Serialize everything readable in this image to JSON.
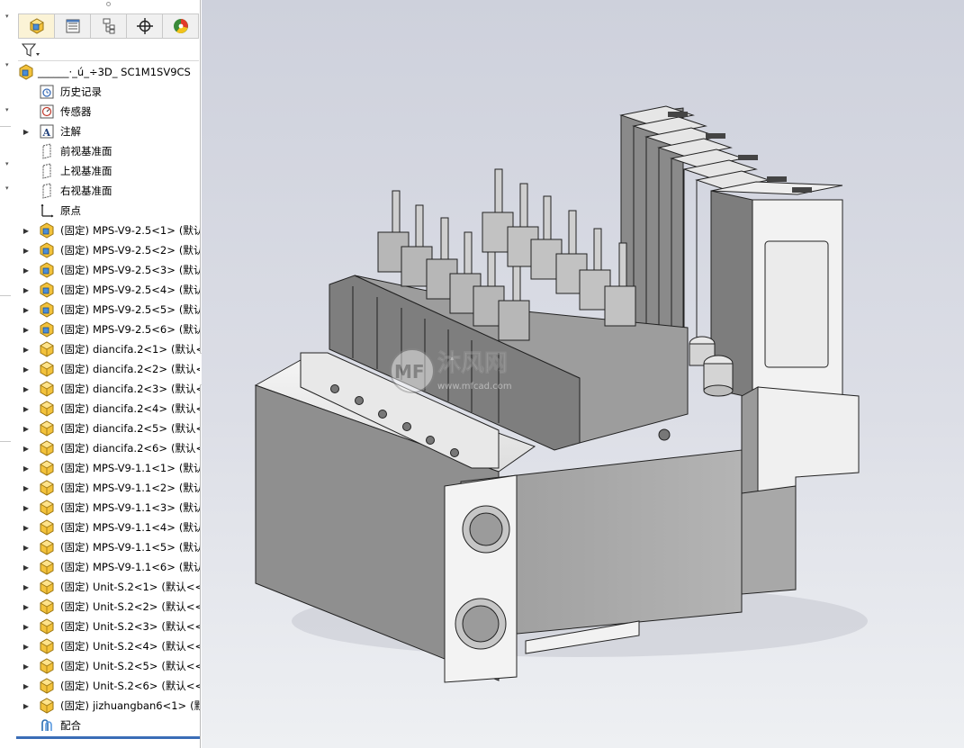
{
  "panel": {
    "tabs": [
      {
        "icon": "feature-manager-icon"
      },
      {
        "icon": "property-manager-icon"
      },
      {
        "icon": "configuration-manager-icon"
      },
      {
        "icon": "dimxpert-icon"
      },
      {
        "icon": "display-manager-icon"
      }
    ],
    "filter_icon": "filter-icon"
  },
  "tree": {
    "root": "______·_ú_÷3D_ SC1M1SV9CS",
    "history": "历史记录",
    "sensors": "传感器",
    "annotations": "注解",
    "front_plane": "前视基准面",
    "top_plane": "上视基准面",
    "right_plane": "右视基准面",
    "origin": "原点",
    "fixed_label": "(固定)",
    "components": [
      {
        "name": "MPS-V9-2.5<1>",
        "config": "(默认",
        "kind": "assembly"
      },
      {
        "name": "MPS-V9-2.5<2>",
        "config": "(默认",
        "kind": "assembly"
      },
      {
        "name": "MPS-V9-2.5<3>",
        "config": "(默认",
        "kind": "assembly"
      },
      {
        "name": "MPS-V9-2.5<4>",
        "config": "(默认",
        "kind": "assembly"
      },
      {
        "name": "MPS-V9-2.5<5>",
        "config": "(默认",
        "kind": "assembly"
      },
      {
        "name": "MPS-V9-2.5<6>",
        "config": "(默认",
        "kind": "assembly"
      },
      {
        "name": "diancifa.2<1>",
        "config": "(默认<",
        "kind": "part"
      },
      {
        "name": "diancifa.2<2>",
        "config": "(默认<",
        "kind": "part"
      },
      {
        "name": "diancifa.2<3>",
        "config": "(默认<",
        "kind": "part"
      },
      {
        "name": "diancifa.2<4>",
        "config": "(默认<",
        "kind": "part"
      },
      {
        "name": "diancifa.2<5>",
        "config": "(默认<",
        "kind": "part"
      },
      {
        "name": "diancifa.2<6>",
        "config": "(默认<",
        "kind": "part"
      },
      {
        "name": "MPS-V9-1.1<1>",
        "config": "(默认",
        "kind": "part"
      },
      {
        "name": "MPS-V9-1.1<2>",
        "config": "(默认",
        "kind": "part"
      },
      {
        "name": "MPS-V9-1.1<3>",
        "config": "(默认",
        "kind": "part"
      },
      {
        "name": "MPS-V9-1.1<4>",
        "config": "(默认",
        "kind": "part"
      },
      {
        "name": "MPS-V9-1.1<5>",
        "config": "(默认",
        "kind": "part"
      },
      {
        "name": "MPS-V9-1.1<6>",
        "config": "(默认",
        "kind": "part"
      },
      {
        "name": "Unit-S.2<1>",
        "config": "(默认<<",
        "kind": "part"
      },
      {
        "name": "Unit-S.2<2>",
        "config": "(默认<<",
        "kind": "part"
      },
      {
        "name": "Unit-S.2<3>",
        "config": "(默认<<",
        "kind": "part"
      },
      {
        "name": "Unit-S.2<4>",
        "config": "(默认<<",
        "kind": "part"
      },
      {
        "name": "Unit-S.2<5>",
        "config": "(默认<<",
        "kind": "part"
      },
      {
        "name": "Unit-S.2<6>",
        "config": "(默认<<",
        "kind": "part"
      },
      {
        "name": "jizhuangban6<1>",
        "config": "(默",
        "kind": "part"
      }
    ],
    "mates": "配合"
  },
  "viewport": {
    "watermark_text": "沐风网",
    "watermark_url": "www.mfcad.com"
  },
  "colors": {
    "panel_bg": "#ffffff",
    "active_tab": "#fbf3d6",
    "accent": "#3a6db7",
    "viewport_top": "#ced1dc",
    "viewport_bottom": "#eef0f3"
  }
}
